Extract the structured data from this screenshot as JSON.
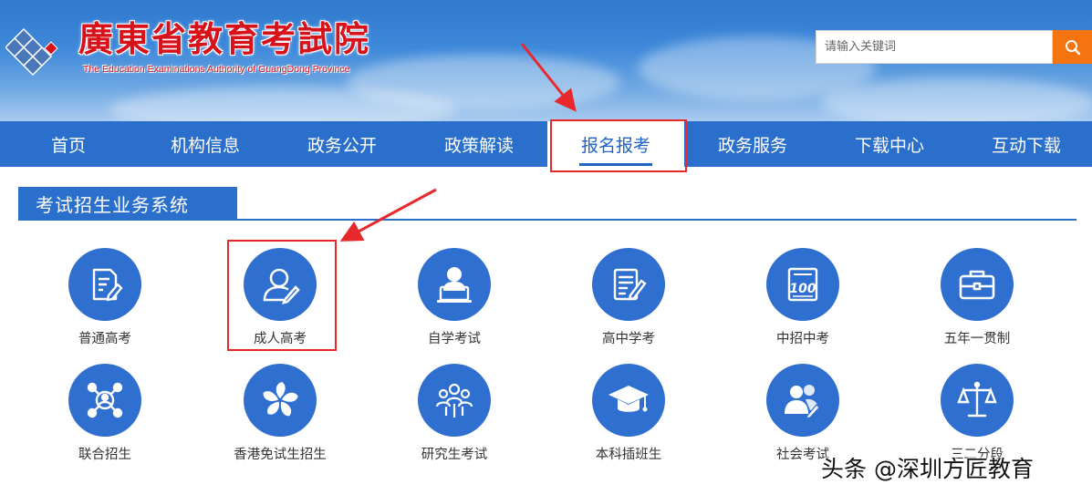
{
  "header": {
    "title": "廣東省教育考試院",
    "subtitle": "The Education Examinations Authority of GuangDong Province",
    "search_placeholder": "请输入关键词",
    "accent": "#2a6fcb",
    "title_color": "#d8121a",
    "search_button_color": "#f5740f"
  },
  "nav": {
    "items": [
      {
        "label": "首页"
      },
      {
        "label": "机构信息"
      },
      {
        "label": "政务公开"
      },
      {
        "label": "政策解读"
      },
      {
        "label": "报名报考",
        "active": true
      },
      {
        "label": "政务服务"
      },
      {
        "label": "下载中心"
      },
      {
        "label": "互动下载"
      }
    ]
  },
  "section": {
    "title": "考试招生业务系统"
  },
  "services": [
    {
      "label": "普通高考",
      "icon": "document-pen-icon"
    },
    {
      "label": "成人高考",
      "icon": "person-pen-icon",
      "highlighted": true
    },
    {
      "label": "自学考试",
      "icon": "person-laptop-icon"
    },
    {
      "label": "高中学考",
      "icon": "checklist-pen-icon"
    },
    {
      "label": "中招中考",
      "icon": "score-100-icon"
    },
    {
      "label": "五年一贯制",
      "icon": "briefcase-icon"
    },
    {
      "label": "联合招生",
      "icon": "network-people-icon"
    },
    {
      "label": "香港免试生招生",
      "icon": "bauhinia-flower-icon"
    },
    {
      "label": "研究生考试",
      "icon": "group-people-icon"
    },
    {
      "label": "本科插班生",
      "icon": "graduation-cap-icon"
    },
    {
      "label": "社会考试",
      "icon": "people-pen-icon"
    },
    {
      "label": "三二分段",
      "icon": "balance-scale-icon"
    }
  ],
  "watermark": "头条 @深圳方匠教育",
  "annotation_color": "#e8282c"
}
